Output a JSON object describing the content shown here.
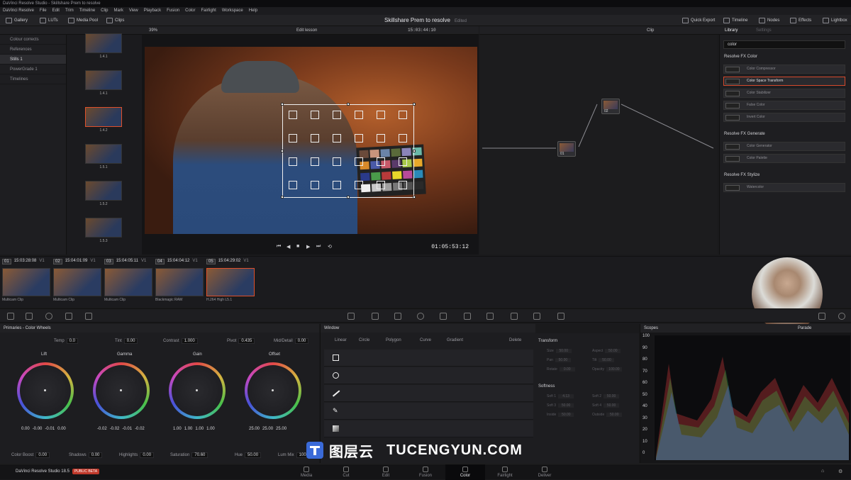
{
  "titlebar": {
    "text": "DaVinci Resolve Studio - Skillshare Prem to resolve"
  },
  "menu": [
    "DaVinci Resolve",
    "File",
    "Edit",
    "Trim",
    "Timeline",
    "Clip",
    "Mark",
    "View",
    "Playback",
    "Fusion",
    "Color",
    "Fairlight",
    "Workspace",
    "Help"
  ],
  "topbar": {
    "gallery": "Gallery",
    "luts": "LUTs",
    "media_pool": "Media Pool",
    "clips": "Clips",
    "project": "Skillshare Prem to resolve",
    "edited": "Edited",
    "quick_export": "Quick Export",
    "timeline": "Timeline",
    "nodes": "Nodes",
    "effects": "Effects",
    "lightbox": "Lightbox"
  },
  "viewer": {
    "zoom": "39%",
    "timeline_name": "Edit lesson",
    "source_tc": "15:03:44:10",
    "clip_label": "Clip",
    "timecode": "01:05:53:12"
  },
  "gallery": {
    "albums": [
      {
        "label": "Colour corrects",
        "selected": false
      },
      {
        "label": "References",
        "selected": false
      },
      {
        "label": "Stills 1",
        "selected": true
      },
      {
        "label": "PowerGrade 1",
        "selected": false
      },
      {
        "label": "Timelines",
        "selected": false
      }
    ],
    "stills": [
      "1.4.1",
      "1.4.1",
      "1.4.2",
      "1.5.1",
      "1.5.2",
      "1.5.3"
    ]
  },
  "effects": {
    "tab_library": "Library",
    "tab_settings": "Settings",
    "search": "color",
    "groups": [
      {
        "title": "Resolve FX Color",
        "items": [
          "Color Compressor",
          "Color Space Transform",
          "Color Stabilizer",
          "False Color",
          "Invert Color"
        ]
      },
      {
        "title": "Resolve FX Generate",
        "items": [
          "Color Generator",
          "Color Palette"
        ]
      },
      {
        "title": "Resolve FX Stylize",
        "items": [
          "Watercolor"
        ]
      }
    ],
    "selected_item": "Color Space Transform"
  },
  "nodes": [
    {
      "label": "01"
    },
    {
      "label": "02"
    }
  ],
  "clips": [
    {
      "num": "01",
      "tc": "15:03:28:08",
      "track": "V1",
      "name": "Multicam Clip"
    },
    {
      "num": "02",
      "tc": "15:04:01:09",
      "track": "V1",
      "name": "Multicam Clip"
    },
    {
      "num": "03",
      "tc": "15:04:05:11",
      "track": "V1",
      "name": "Multicam Clip"
    },
    {
      "num": "04",
      "tc": "15:04:04:12",
      "track": "V1",
      "name": "Blackmagic RAW"
    },
    {
      "num": "05",
      "tc": "15:04:29:02",
      "track": "V1",
      "name": "H.264 High L5.1"
    }
  ],
  "primaries": {
    "title": "Primaries - Color Wheels",
    "temp_label": "Temp",
    "temp": "0.0",
    "tint_label": "Tint",
    "tint": "0.00",
    "contrast_label": "Contrast",
    "contrast": "1.000",
    "pivot_label": "Pivot",
    "pivot": "0.435",
    "middetail_label": "Mid/Detail",
    "middetail": "0.00",
    "wheels": [
      {
        "name": "Lift",
        "values": [
          "0.00",
          "-0.00",
          "-0.01",
          "0.00"
        ]
      },
      {
        "name": "Gamma",
        "values": [
          "-0.02",
          "-0.02",
          "-0.01",
          "-0.02"
        ]
      },
      {
        "name": "Gain",
        "values": [
          "1.00",
          "1.00",
          "1.00",
          "1.00"
        ]
      },
      {
        "name": "Offset",
        "values": [
          "25.00",
          "25.00",
          "25.00"
        ]
      }
    ],
    "colorboost_label": "Color Boost",
    "colorboost": "0.00",
    "shadows_label": "Shadows",
    "shadows": "0.00",
    "highlights_label": "Highlights",
    "highlights": "0.00",
    "saturation_label": "Saturation",
    "saturation": "70.60",
    "hue_label": "Hue",
    "hue": "50.00",
    "lummix_label": "Lum Mix",
    "lummix": "100.00"
  },
  "window": {
    "title": "Window",
    "linear": "Linear",
    "circle": "Circle",
    "polygon": "Polygon",
    "curve": "Curve",
    "gradient": "Gradient",
    "delete": "Delete",
    "transform_title": "Transform",
    "softness_title": "Softness",
    "transform_fields": [
      [
        "Size",
        "50.00",
        "Aspect",
        "50.00"
      ],
      [
        "Pan",
        "50.00",
        "Tilt",
        "50.00"
      ],
      [
        "Rotate",
        "0.00",
        "Opacity",
        "100.00"
      ]
    ],
    "softness_fields": [
      [
        "Soft 1",
        "4.13",
        "Soft 2",
        "50.00"
      ],
      [
        "Soft 3",
        "50.00",
        "Soft 4",
        "50.00"
      ],
      [
        "Inside",
        "50.00",
        "Outside",
        "50.00"
      ]
    ]
  },
  "scopes": {
    "title": "Scopes",
    "mode": "Parade",
    "ticks": [
      "100",
      "90",
      "80",
      "70",
      "60",
      "50",
      "40",
      "30",
      "20",
      "10",
      "0"
    ]
  },
  "pages": [
    "Media",
    "Cut",
    "Edit",
    "Fusion",
    "Color",
    "Fairlight",
    "Deliver"
  ],
  "selected_page": "Color",
  "app": {
    "name": "DaVinci Resolve Studio 18.5",
    "badge": "PUBLIC BETA"
  },
  "watermark": {
    "cn": "图层云",
    "en": "TUCENGYUN.COM"
  }
}
